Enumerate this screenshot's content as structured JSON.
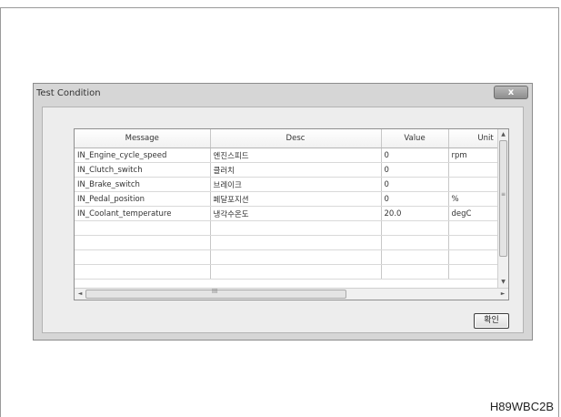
{
  "window": {
    "title": "Test Condition",
    "close_glyph": "x",
    "close_icon": "close-icon"
  },
  "table": {
    "columns": [
      "Message",
      "Desc",
      "Value",
      "Unit"
    ],
    "rows": [
      [
        "IN_Engine_cycle_speed",
        "엔진스피드",
        "0",
        "rpm"
      ],
      [
        "IN_Clutch_switch",
        "클러치",
        "0",
        ""
      ],
      [
        "IN_Brake_switch",
        "브레이크",
        "0",
        ""
      ],
      [
        "IN_Pedal_position",
        "페달포지션",
        "0",
        "%"
      ],
      [
        "IN_Coolant_temperature",
        "냉각수온도",
        "20.0",
        "degC"
      ],
      [
        "",
        "",
        "",
        ""
      ],
      [
        "",
        "",
        "",
        ""
      ],
      [
        "",
        "",
        "",
        ""
      ],
      [
        "",
        "",
        "",
        ""
      ]
    ]
  },
  "scrollbars": {
    "up_glyph": "▲",
    "down_glyph": "▼",
    "left_glyph": "◄",
    "right_glyph": "►",
    "v_grip": "≡",
    "h_grip": "III"
  },
  "buttons": {
    "ok_label": "확인"
  },
  "figure_code": "H89WBC2B"
}
